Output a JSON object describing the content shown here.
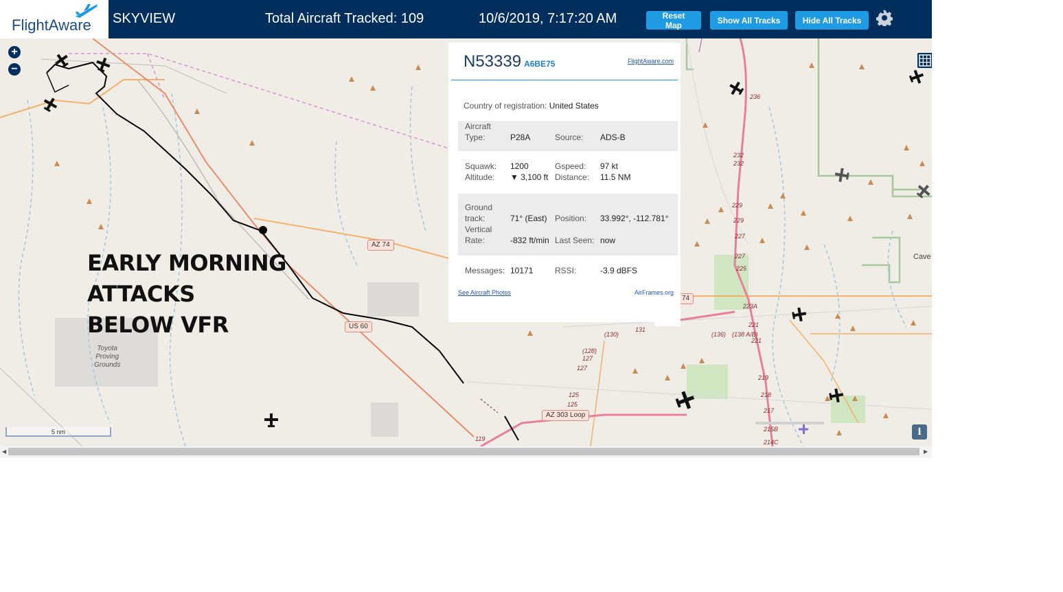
{
  "header": {
    "logo_text": "FlightAware",
    "app_title": "SKYVIEW",
    "aircraft_tracked": "Total Aircraft Tracked: 109",
    "datetime": "10/6/2019, 7:17:20 AM",
    "reset_label": "Reset Map",
    "show_tracks_label": "Show All Tracks",
    "hide_tracks_label": "Hide All Tracks",
    "settings_icon": "gear-icon"
  },
  "zoom": {
    "in": "+",
    "out": "−"
  },
  "overlay_text": [
    "EARLY MORNING",
    "ATTACKS",
    "BELOW VFR"
  ],
  "popup": {
    "flight_id": "N53339",
    "hex_id": "A6BE75",
    "flightaware_link": "FlightAware.com",
    "country_label": "Country of registration:",
    "country_value": "United States",
    "aircraft_type_label": "Aircraft\nType:",
    "aircraft_type_value": "P28A",
    "source_label": "Source:",
    "source_value": "ADS-B",
    "squawk_label": "Squawk:",
    "squawk_value": "1200",
    "altitude_label": "Altitude:",
    "altitude_value": "▼ 3,100 ft",
    "gspeed_label": "Gspeed:",
    "gspeed_value": "97 kt",
    "distance_label": "Distance:",
    "distance_value": "11.5 NM",
    "ground_track_label": "Ground\ntrack:",
    "ground_track_value": "71° (East)",
    "position_label": "Position:",
    "position_value": "33.992°, -112.781°",
    "vertical_rate_label": "Vertical\nRate:",
    "vertical_rate_value": "-832 ft/min",
    "last_seen_label": "Last Seen:",
    "last_seen_value": "now",
    "messages_label": "Messages:",
    "messages_value": "10171",
    "rssi_label": "RSSI:",
    "rssi_value": "-3.9 dBFS",
    "photos_link": "See Aircraft Photos",
    "airframes_link": "AirFrames.org"
  },
  "map_labels": {
    "az74": "AZ 74",
    "az74_right": "74",
    "us60": "US 60",
    "az303": "AZ 303 Loop",
    "toyota": "Toyota\nProving\nGrounds",
    "cave": "Cave",
    "scale": "5 nm",
    "info": "i",
    "route_119": "119",
    "mile_markers": [
      "236",
      "232",
      "232",
      "229",
      "229",
      "227",
      "227",
      "225",
      "223A",
      "221",
      "221",
      "219",
      "218",
      "217",
      "215B",
      "214C",
      "(130)",
      "131",
      "(128)",
      "127",
      "127",
      "125",
      "125",
      "(136)",
      "(138 A/B)"
    ]
  },
  "colors": {
    "header_bg": "#002f5d",
    "button_bg": "#1f9be3",
    "map_bg": "#f0ede6",
    "track_color": "#000000"
  }
}
